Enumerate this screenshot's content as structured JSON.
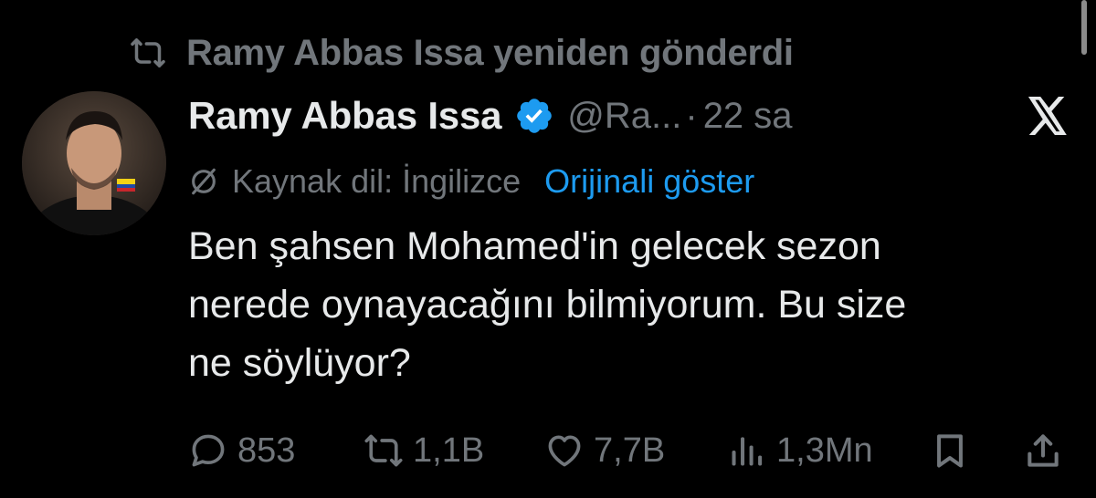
{
  "repost": {
    "text": "Ramy Abbas Issa yeniden gönderdi",
    "icon": "repost-icon"
  },
  "author": {
    "name": "Ramy Abbas Issa",
    "handle": "@Ra...",
    "time_separator": "·",
    "time": "22 sa",
    "verified_icon": "verified-badge-icon",
    "verified_color": "#1d9bf0"
  },
  "translation": {
    "source_language": "Kaynak dil: İngilizce",
    "show_original": "Orijinali göster",
    "link_color": "#1d9bf0"
  },
  "tweet": {
    "lines": [
      "Ben şahsen Mohamed'in gelecek sezon",
      "nerede oynayacağını bilmiyorum. Bu size",
      "ne söylüyor?"
    ]
  },
  "actions": {
    "replies": "853",
    "reposts": "1,1B",
    "likes": "7,7B",
    "views": "1,3Mn"
  },
  "colors": {
    "background": "#000000",
    "primary_text": "#e7e9ea",
    "secondary_text": "#71767b"
  }
}
